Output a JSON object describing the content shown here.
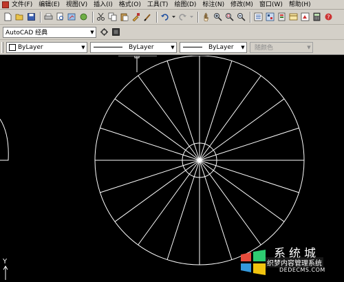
{
  "menubar": {
    "items": [
      "文件(F)",
      "编辑(E)",
      "视图(V)",
      "插入(I)",
      "格式(O)",
      "工具(T)",
      "绘图(D)",
      "标注(N)",
      "修改(M)",
      "窗口(W)",
      "帮助(H)"
    ]
  },
  "toolbar": {
    "icons": [
      "new-icon",
      "open-icon",
      "save-icon",
      "print-icon",
      "preview-icon",
      "publish-icon",
      "cut-icon",
      "copy-icon",
      "paste-icon",
      "match-properties-icon",
      "brush-icon",
      "undo-icon",
      "redo-icon",
      "pan-icon",
      "zoom-realtime-icon",
      "zoom-window-icon",
      "zoom-previous-icon",
      "properties-icon",
      "design-center-icon",
      "tool-palettes-icon",
      "sheet-set-icon",
      "markup-icon",
      "calculator-icon"
    ]
  },
  "workspace": {
    "value": "AutoCAD 经典"
  },
  "properties": {
    "color_value": "ByLayer",
    "linetype_value": "ByLayer",
    "lineweight_value": "ByLayer",
    "plotstyle_value": "随颜色"
  },
  "drawing": {
    "shape": "circle divided into 20 equal sectors with a small inner circle",
    "outer_circle_color": "#ffffff",
    "segments": 20,
    "axis_label": "Y"
  },
  "watermark": {
    "title": "系统城",
    "subtitle": "织梦内容管理系统",
    "url": "DEDECMS.COM"
  },
  "colors": {
    "chrome": "#d4d0c8",
    "canvas": "#000000",
    "lines": "#ffffff"
  }
}
